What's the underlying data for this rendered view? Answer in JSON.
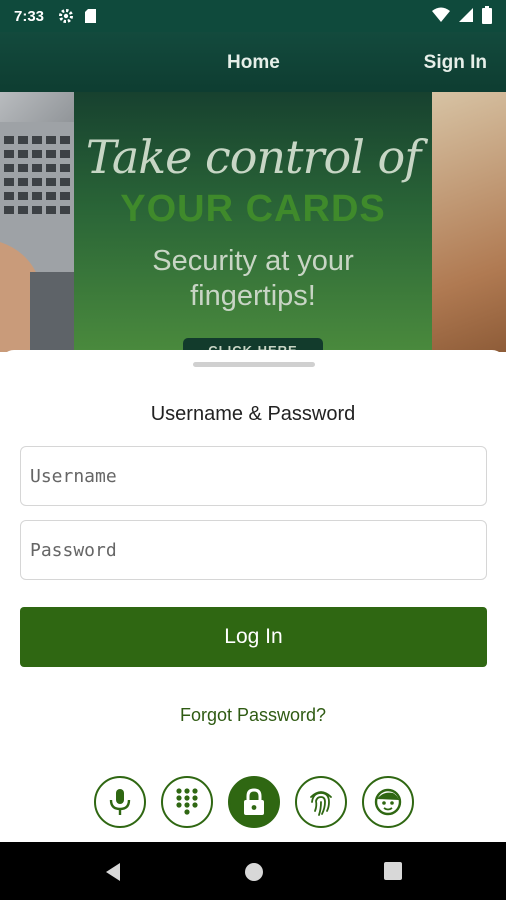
{
  "status_bar": {
    "time": "7:33",
    "left_icons": [
      "gear-icon",
      "sd-card-icon"
    ],
    "right_icons": [
      "wifi-icon",
      "signal-icon",
      "battery-icon"
    ]
  },
  "nav": {
    "home_label": "Home",
    "signin_label": "Sign In"
  },
  "banner": {
    "script_text": "Take control of",
    "headline": "YOUR CARDS",
    "tagline": "Security at your fingertips!",
    "cta_label": "CLICK HERE"
  },
  "login_sheet": {
    "title": "Username & Password",
    "username_placeholder": "Username",
    "password_placeholder": "Password",
    "login_label": "Log In",
    "forgot_label": "Forgot Password?",
    "auth_methods": [
      {
        "icon": "microphone-icon",
        "active": false
      },
      {
        "icon": "keypad-icon",
        "active": false
      },
      {
        "icon": "lock-icon",
        "active": true
      },
      {
        "icon": "fingerprint-icon",
        "active": false
      },
      {
        "icon": "face-icon",
        "active": false
      }
    ]
  },
  "android_nav": [
    "back-icon",
    "home-circle-icon",
    "recents-icon"
  ],
  "colors": {
    "primary": "#2f6712",
    "header": "#0f4a3c",
    "link": "#2f5b13"
  }
}
